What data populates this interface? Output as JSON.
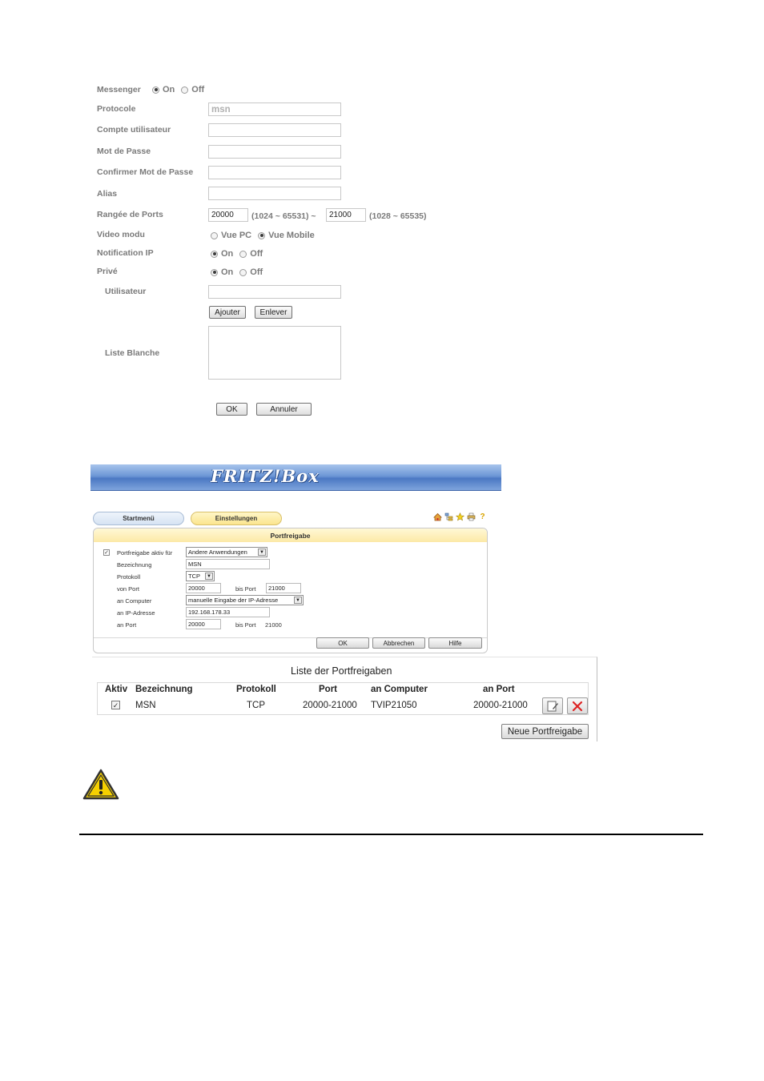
{
  "messenger": {
    "messenger_label": "Messenger",
    "on_label": "On",
    "off_label": "Off",
    "protocol_label": "Protocole",
    "protocol_placeholder": "msn",
    "account_label": "Compte utilisateur",
    "password_label": "Mot de Passe",
    "confirm_password_label": "Confirmer Mot de Passe",
    "alias_label": "Alias",
    "port_range_label": "Rangée de Ports",
    "port_from": "20000",
    "port_from_hint": "(1024 ~ 65531) ~",
    "port_to": "21000",
    "port_to_hint": "(1028 ~ 65535)",
    "video_mode_label": "Video modu",
    "video_pc_label": "Vue PC",
    "video_mobile_label": "Vue Mobile",
    "ip_notification_label": "Notification IP",
    "private_label": "Privé",
    "user_label": "Utilisateur",
    "add_button": "Ajouter",
    "remove_button": "Enlever",
    "whitelist_label": "Liste Blanche",
    "ok_button": "OK",
    "cancel_button": "Annuler"
  },
  "fritzbox": {
    "logo": "FRITZ!Box",
    "tabs": [
      "Startmenü",
      "Einstellungen"
    ],
    "panel_title": "Portfreigabe",
    "active_for_label": "Portfreigabe aktiv für",
    "active_for_value": "Andere Anwendungen",
    "name_label": "Bezeichnung",
    "name_value": "MSN",
    "protocol_label": "Protokoll",
    "protocol_value": "TCP",
    "from_port_label": "von Port",
    "from_port_value": "20000",
    "to_port_label": "bis Port",
    "to_port_value": "21000",
    "computer_label": "an Computer",
    "computer_value": "manuelle Eingabe der IP-Adresse",
    "ip_label": "an IP-Adresse",
    "ip_value": "192.168.178.33",
    "dest_port_label": "an Port",
    "dest_port_value": "20000",
    "dest_to_port_label": "bis Port",
    "dest_to_port_value": "21000",
    "ok_button": "OK",
    "cancel_button": "Abbrechen",
    "help_button": "Hilfe",
    "icons": [
      "home-icon",
      "tree-icon",
      "star-icon",
      "print-icon",
      "help-icon"
    ]
  },
  "port_list": {
    "title": "Liste der Portfreigaben",
    "headers": [
      "Aktiv",
      "Bezeichnung",
      "Protokoll",
      "Port",
      "an Computer",
      "an Port"
    ],
    "rows": [
      {
        "active": true,
        "name": "MSN",
        "protocol": "TCP",
        "port": "20000-21000",
        "computer": "TVIP21050",
        "dest_port": "20000-21000"
      }
    ],
    "new_button": "Neue Portfreigabe"
  },
  "colors": {
    "warning_yellow": "#f5d000",
    "banner_blue": "#5b86cc",
    "tab_yellow": "#fbe58e"
  }
}
